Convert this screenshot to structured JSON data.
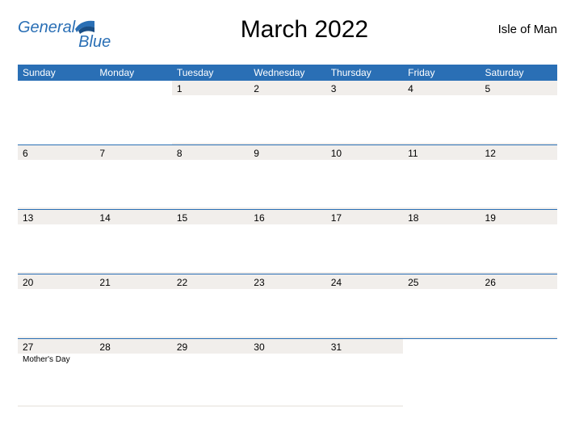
{
  "logo": {
    "word1": "General",
    "word2": "Blue"
  },
  "title": "March 2022",
  "region": "Isle of Man",
  "days_of_week": [
    "Sunday",
    "Monday",
    "Tuesday",
    "Wednesday",
    "Thursday",
    "Friday",
    "Saturday"
  ],
  "weeks": [
    [
      {
        "n": "",
        "event": ""
      },
      {
        "n": "",
        "event": ""
      },
      {
        "n": "1",
        "event": ""
      },
      {
        "n": "2",
        "event": ""
      },
      {
        "n": "3",
        "event": ""
      },
      {
        "n": "4",
        "event": ""
      },
      {
        "n": "5",
        "event": ""
      }
    ],
    [
      {
        "n": "6",
        "event": ""
      },
      {
        "n": "7",
        "event": ""
      },
      {
        "n": "8",
        "event": ""
      },
      {
        "n": "9",
        "event": ""
      },
      {
        "n": "10",
        "event": ""
      },
      {
        "n": "11",
        "event": ""
      },
      {
        "n": "12",
        "event": ""
      }
    ],
    [
      {
        "n": "13",
        "event": ""
      },
      {
        "n": "14",
        "event": ""
      },
      {
        "n": "15",
        "event": ""
      },
      {
        "n": "16",
        "event": ""
      },
      {
        "n": "17",
        "event": ""
      },
      {
        "n": "18",
        "event": ""
      },
      {
        "n": "19",
        "event": ""
      }
    ],
    [
      {
        "n": "20",
        "event": ""
      },
      {
        "n": "21",
        "event": ""
      },
      {
        "n": "22",
        "event": ""
      },
      {
        "n": "23",
        "event": ""
      },
      {
        "n": "24",
        "event": ""
      },
      {
        "n": "25",
        "event": ""
      },
      {
        "n": "26",
        "event": ""
      }
    ],
    [
      {
        "n": "27",
        "event": "Mother's Day"
      },
      {
        "n": "28",
        "event": ""
      },
      {
        "n": "29",
        "event": ""
      },
      {
        "n": "30",
        "event": ""
      },
      {
        "n": "31",
        "event": ""
      },
      {
        "n": "",
        "event": ""
      },
      {
        "n": "",
        "event": ""
      }
    ]
  ]
}
